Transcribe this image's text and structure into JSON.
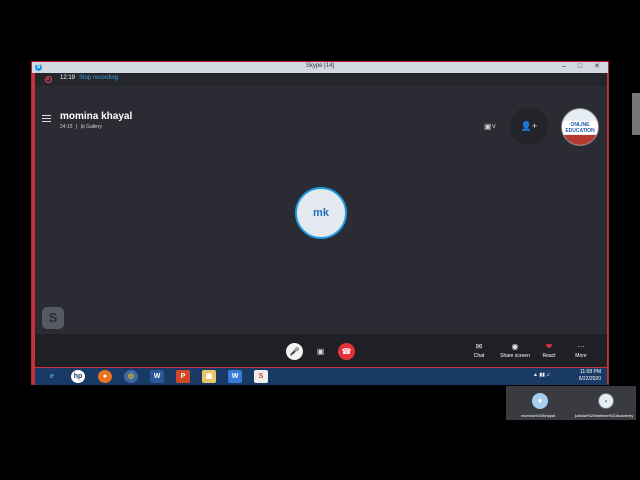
{
  "window": {
    "title": "Skype [14]"
  },
  "recording": {
    "time": "12:19",
    "stop_label": "Stop recording"
  },
  "call": {
    "contact_name": "momina khayal",
    "duration": "24:15",
    "view_mode": "Gallery",
    "avatar_initials": "mk"
  },
  "thumbnail": {
    "text": "ONLINE EDUCATION"
  },
  "controls": {
    "chat_label": "Chat",
    "share_label": "Share screen",
    "react_label": "React",
    "more_label": "More"
  },
  "taskbar": {
    "time": "11:08 PM",
    "date": "6/22/2020"
  },
  "participants": [
    {
      "name": "momina%20khayal"
    },
    {
      "name": "judicial%20intellect%20Academy"
    }
  ],
  "colors": {
    "accent": "#1d9ae2",
    "hangup": "#e2323a",
    "frame": "#c8323a",
    "call_bg": "#2b2c33"
  },
  "icons": {
    "mic": "microphone-icon",
    "camera": "video-off-icon",
    "hangup": "hang-up-icon",
    "chat": "chat-icon",
    "share": "share-screen-icon",
    "react": "heart-icon",
    "more": "more-icon"
  }
}
